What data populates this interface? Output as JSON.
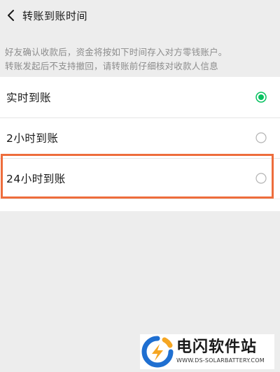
{
  "header": {
    "title": "转账到账时间",
    "back_icon": "chevron-left-icon"
  },
  "notice": {
    "line1": "好友确认收款后，资金将按如下时间存入对方零钱账户。",
    "line2": "转账发起后不支持撤回，请转账前仔细核对收款人信息"
  },
  "options": [
    {
      "label": "实时到账",
      "selected": true
    },
    {
      "label": "2小时到账",
      "selected": false
    },
    {
      "label": "24小时到账",
      "selected": false
    }
  ],
  "colors": {
    "accent": "#07c160",
    "highlight": "#ee6d3c",
    "background": "#ededed"
  },
  "watermark": {
    "title": "电闪软件站",
    "subtitle": "WWW.DS-SOLARBATTERY.COM"
  }
}
